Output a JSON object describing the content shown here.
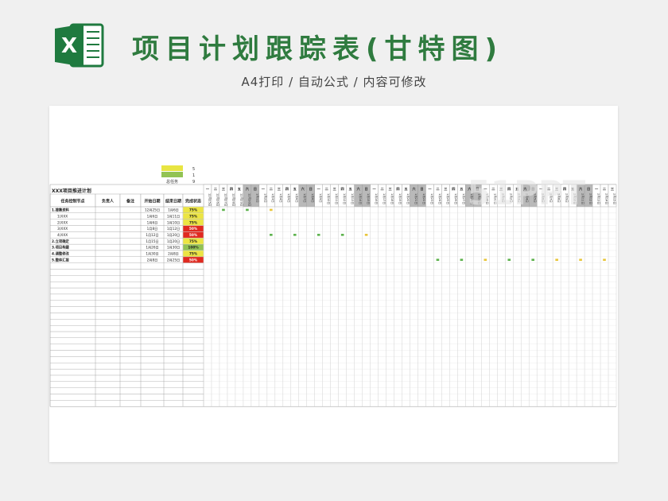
{
  "header": {
    "title": "项目计划跟踪表(甘特图)",
    "subtitle": "A4打印 / 自动公式 / 内容可修改",
    "logo_letter": "X",
    "logo_icon": "excel-icon"
  },
  "legend": {
    "rows": [
      {
        "color": "#e8e542",
        "value": "5"
      },
      {
        "color": "#92c353",
        "value": "1"
      }
    ],
    "total_label": "总任务",
    "total_value": "9"
  },
  "sheet": {
    "title": "XXX项目推进计划",
    "headers": [
      "任务控制节点",
      "负责人",
      "备注",
      "开始日期",
      "结束日期",
      "完成状态"
    ],
    "rows": [
      {
        "task": "1.搜集资料",
        "start": "12月25日",
        "end": "1月6日",
        "status": "75%",
        "status_color": "#ece543"
      },
      {
        "task": "1)XXX",
        "start": "1月6日",
        "end": "1月11日",
        "status": "75%",
        "status_color": "#ece543"
      },
      {
        "task": "2)XXX",
        "start": "1月6日",
        "end": "1月10日",
        "status": "75%",
        "status_color": "#ece543"
      },
      {
        "task": "3)XXX",
        "start": "1月8日",
        "end": "1月12日",
        "status": "50%",
        "status_color": "#e02a20"
      },
      {
        "task": "4)XXX",
        "start": "1月12日",
        "end": "1月20日",
        "status": "50%",
        "status_color": "#e02a20"
      },
      {
        "task": "2.立项确定",
        "start": "1月15日",
        "end": "1月20日",
        "status": "75%",
        "status_color": "#ece543"
      },
      {
        "task": "3.项目构建",
        "start": "1月26日",
        "end": "1月30日",
        "status": "100%",
        "status_color": "#92c353"
      },
      {
        "task": "4.调整修改",
        "start": "1月30日",
        "end": "2月8日",
        "status": "75%",
        "status_color": "#ece543"
      },
      {
        "task": "5.整体汇报",
        "start": "2月8日",
        "end": "2月25日",
        "status": "50%",
        "status_color": "#e02a20"
      }
    ],
    "gantt_marks": [
      {
        "row": 0,
        "col": 2,
        "color": "#5db24d"
      },
      {
        "row": 0,
        "col": 5,
        "color": "#5db24d"
      },
      {
        "row": 0,
        "col": 8,
        "color": "#e8c53a"
      },
      {
        "row": 4,
        "col": 8,
        "color": "#5db24d"
      },
      {
        "row": 4,
        "col": 11,
        "color": "#5db24d"
      },
      {
        "row": 4,
        "col": 14,
        "color": "#5db24d"
      },
      {
        "row": 4,
        "col": 17,
        "color": "#5db24d"
      },
      {
        "row": 4,
        "col": 20,
        "color": "#e8c53a"
      },
      {
        "row": 8,
        "col": 29,
        "color": "#5db24d"
      },
      {
        "row": 8,
        "col": 32,
        "color": "#5db24d"
      },
      {
        "row": 8,
        "col": 35,
        "color": "#e8c53a"
      },
      {
        "row": 8,
        "col": 38,
        "color": "#5db24d"
      },
      {
        "row": 8,
        "col": 41,
        "color": "#5db24d"
      },
      {
        "row": 8,
        "col": 44,
        "color": "#e8c53a"
      },
      {
        "row": 8,
        "col": 47,
        "color": "#e8c53a"
      },
      {
        "row": 8,
        "col": 50,
        "color": "#e8c53a"
      }
    ],
    "weekdays": [
      "一",
      "二",
      "三",
      "四",
      "五",
      "六",
      "日"
    ],
    "date_months": [
      "12月",
      "1月",
      "2月"
    ]
  },
  "watermark": "51PPT"
}
